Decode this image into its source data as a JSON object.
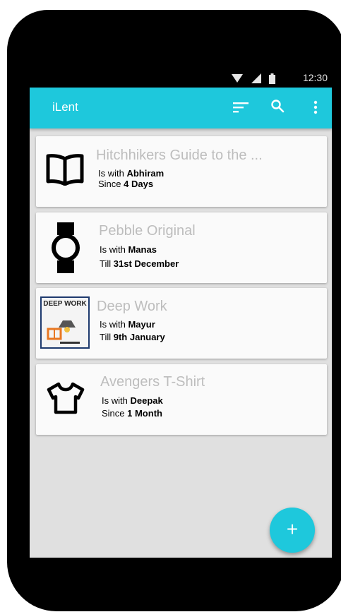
{
  "status": {
    "time": "12:30",
    "icons": [
      "wifi-icon",
      "signal-icon",
      "battery-icon"
    ]
  },
  "appbar": {
    "title": "iLent",
    "icons": [
      "sort-icon",
      "search-icon",
      "more-vert-icon"
    ]
  },
  "items": [
    {
      "icon": "book-icon",
      "title": "Hitchhikers Guide to the ...",
      "prefix1": "Is with ",
      "person": "Abhiram",
      "prefix2": "Since ",
      "time": "4 Days"
    },
    {
      "icon": "watch-icon",
      "title": "Pebble Original",
      "prefix1": "Is with ",
      "person": "Manas",
      "prefix2": "Till ",
      "time": "31st December"
    },
    {
      "icon": "deep-work-cover-image",
      "cover_text": "DEEP WORK",
      "title": "Deep Work",
      "prefix1": "Is with ",
      "person": "Mayur",
      "prefix2": "Till ",
      "time": "9th January"
    },
    {
      "icon": "t-shirt-icon",
      "title": "Avengers T-Shirt",
      "prefix1": "Is with ",
      "person": "Deepak",
      "prefix2": "Since ",
      "time": "1 Month"
    }
  ],
  "fab": {
    "label": "+"
  },
  "colors": {
    "accent": "#1ec8dc",
    "card": "#fafafa",
    "background": "#e0e0e0",
    "title_gray": "#bdbdbd"
  }
}
